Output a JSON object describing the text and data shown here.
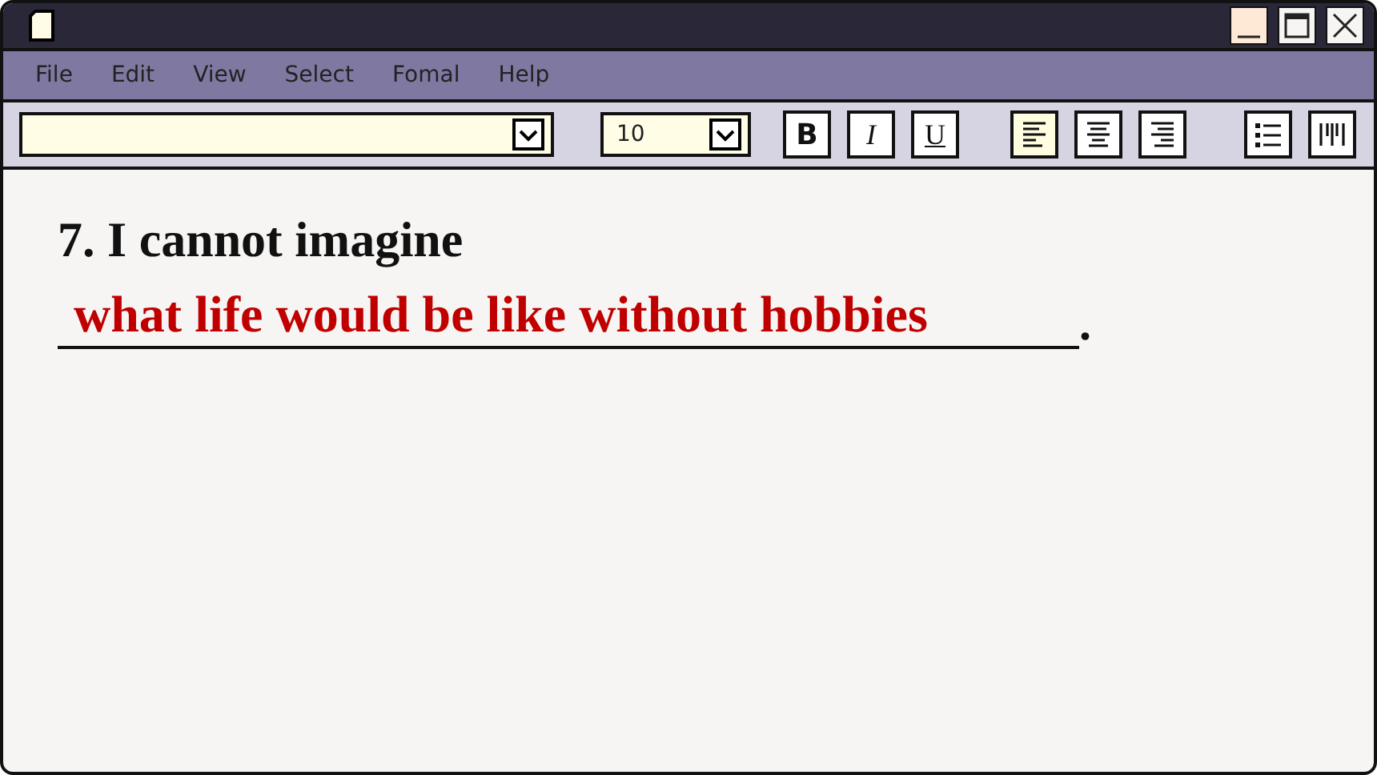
{
  "menu": [
    "File",
    "Edit",
    "View",
    "Select",
    "Fomal",
    "Help"
  ],
  "toolbar": {
    "size": "10",
    "format_buttons": [
      {
        "label": "B",
        "kind": "bold"
      },
      {
        "label": "I",
        "kind": "italic"
      },
      {
        "label": "U",
        "kind": "underline"
      }
    ],
    "align_buttons": [
      {
        "kind": "left",
        "selected": true
      },
      {
        "kind": "center",
        "selected": false
      },
      {
        "kind": "right",
        "selected": false
      }
    ]
  },
  "content": {
    "question": "7. I cannot imagine",
    "answer": "what life would be like without hobbies",
    "end": "."
  }
}
